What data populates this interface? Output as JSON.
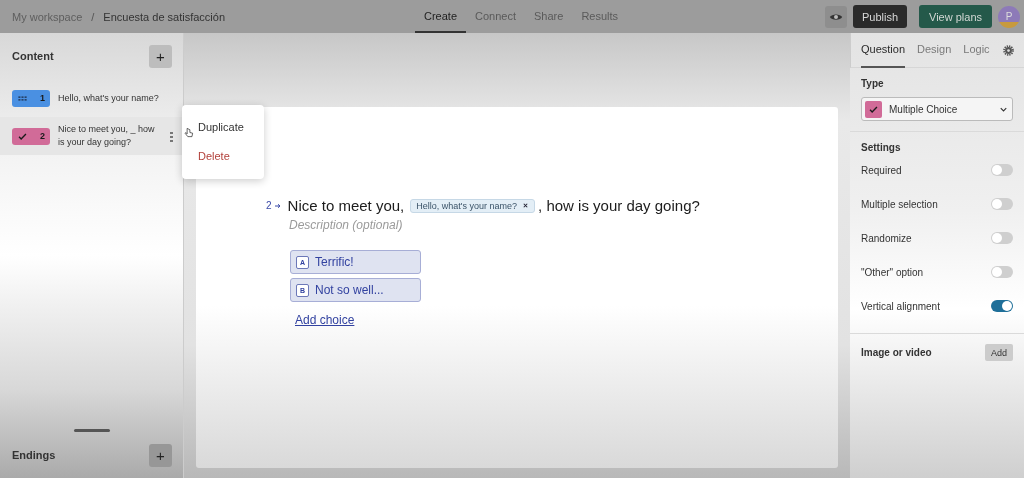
{
  "breadcrumb": {
    "workspace": "My workspace",
    "separator": "/",
    "form": "Encuesta de satisfacción"
  },
  "nav_tabs": [
    {
      "label": "Create",
      "selected": true
    },
    {
      "label": "Connect",
      "selected": false
    },
    {
      "label": "Share",
      "selected": false
    },
    {
      "label": "Results",
      "selected": false
    }
  ],
  "header_buttons": {
    "publish": "Publish",
    "view_plans": "View plans",
    "avatar": "P"
  },
  "sidebar": {
    "title": "Content",
    "add": "+",
    "items": [
      {
        "kind": "short_text",
        "number": "1",
        "text": "Hello, what's your name?",
        "color": "#4a90e2",
        "selected": false
      },
      {
        "kind": "multiple_choice",
        "number": "2",
        "text": "Nice to meet you, _ how is your day going?",
        "color": "#d16b98",
        "selected": true
      }
    ],
    "endings_title": "Endings",
    "endings_add": "+"
  },
  "context_menu": [
    {
      "label": "Duplicate",
      "kind": "normal"
    },
    {
      "label": "Delete",
      "kind": "danger"
    }
  ],
  "question": {
    "number": "2",
    "title_before": "Nice to meet you,",
    "recall_chip": "Hello, what's your name?",
    "title_after": ", how is your day going?",
    "description_placeholder": "Description (optional)",
    "choices": [
      {
        "key": "A",
        "label": "Terrific!"
      },
      {
        "key": "B",
        "label": "Not so well..."
      }
    ],
    "add_choice": "Add choice"
  },
  "panel_tabs": [
    {
      "label": "Question",
      "selected": true
    },
    {
      "label": "Design",
      "selected": false
    },
    {
      "label": "Logic",
      "selected": false
    }
  ],
  "panel": {
    "type_title": "Type",
    "type": {
      "value": "Multiple Choice",
      "color": "#d16b98"
    },
    "settings_title": "Settings",
    "settings": [
      {
        "label": "Required",
        "on": false
      },
      {
        "label": "Multiple selection",
        "on": false
      },
      {
        "label": "Randomize",
        "on": false
      },
      {
        "label": "\"Other\" option",
        "on": false
      },
      {
        "label": "Vertical alignment",
        "on": true
      }
    ],
    "media_title": "Image or video",
    "media_add": "Add"
  }
}
